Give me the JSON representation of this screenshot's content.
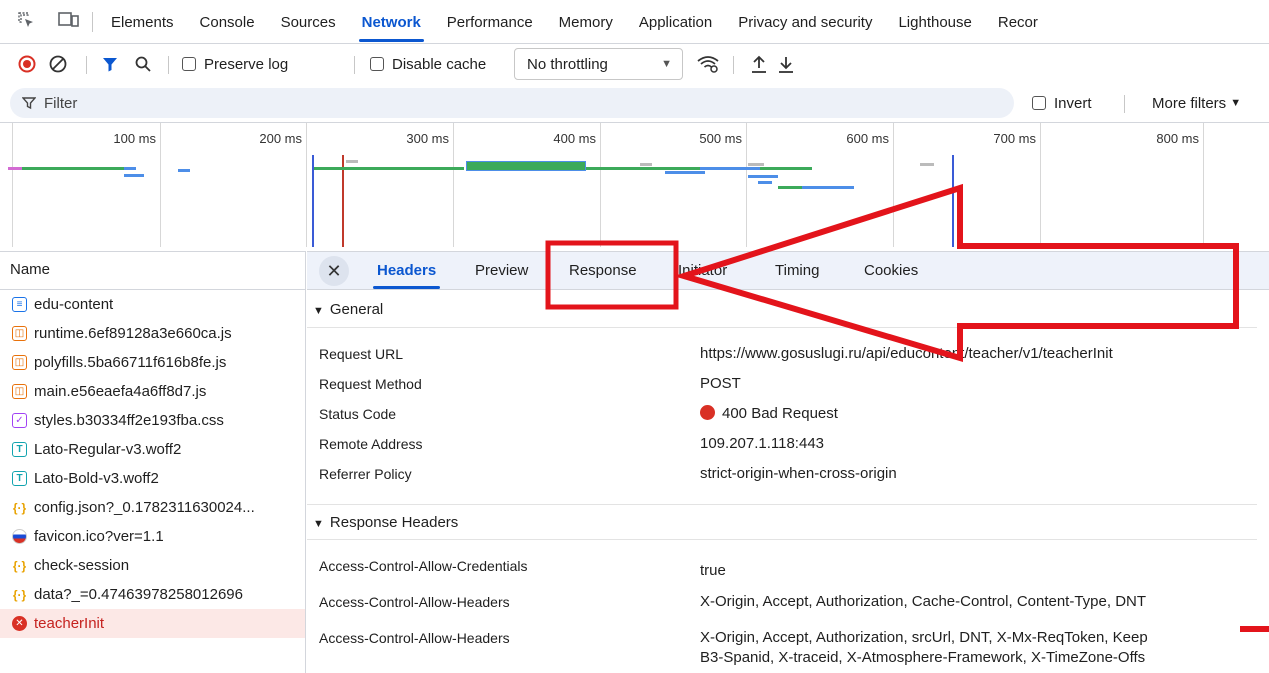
{
  "top_tabs": [
    "Elements",
    "Console",
    "Sources",
    "Network",
    "Performance",
    "Memory",
    "Application",
    "Privacy and security",
    "Lighthouse",
    "Recor"
  ],
  "active_tab": "Network",
  "toolbar": {
    "preserve_log": "Preserve log",
    "disable_cache": "Disable cache",
    "throttling": "No throttling"
  },
  "filter": {
    "placeholder": "Filter",
    "invert": "Invert",
    "more_filters": "More filters"
  },
  "timeline": {
    "ticks": [
      "100 ms",
      "200 ms",
      "300 ms",
      "400 ms",
      "500 ms",
      "600 ms",
      "700 ms",
      "800 ms"
    ]
  },
  "request_list": {
    "header": "Name",
    "items": [
      {
        "name": "edu-content",
        "type": "doc",
        "color": "#1a73e8"
      },
      {
        "name": "runtime.6ef89128a3e660ca.js",
        "type": "script",
        "color": "#e8710a"
      },
      {
        "name": "polyfills.5ba66711f616b8fe.js",
        "type": "script",
        "color": "#e8710a"
      },
      {
        "name": "main.e56eaefa4a6ff8d7.js",
        "type": "script",
        "color": "#e8710a"
      },
      {
        "name": "styles.b30334ff2e193fba.css",
        "type": "style",
        "color": "#a142f4"
      },
      {
        "name": "Lato-Regular-v3.woff2",
        "type": "font",
        "color": "#12a4af"
      },
      {
        "name": "Lato-Bold-v3.woff2",
        "type": "font",
        "color": "#12a4af"
      },
      {
        "name": "config.json?_0.1782311630024...",
        "type": "fetch",
        "color": "#e8a200"
      },
      {
        "name": "favicon.ico?ver=1.1",
        "type": "image",
        "color": "#1a4bd6"
      },
      {
        "name": "check-session",
        "type": "fetch",
        "color": "#e8a200"
      },
      {
        "name": "data?_=0.47463978258012696",
        "type": "fetch",
        "color": "#e8a200"
      },
      {
        "name": "teacherInit",
        "type": "error",
        "color": "#d93025"
      }
    ]
  },
  "detail_tabs": [
    "Headers",
    "Preview",
    "Response",
    "Initiator",
    "Timing",
    "Cookies"
  ],
  "active_detail_tab": "Headers",
  "general": {
    "title": "General",
    "rows": [
      {
        "key": "Request URL",
        "value": "https://www.gosuslugi.ru/api/educontent/teacher/v1/teacherInit"
      },
      {
        "key": "Request Method",
        "value": "POST"
      },
      {
        "key": "Status Code",
        "value": "400 Bad Request"
      },
      {
        "key": "Remote Address",
        "value": "109.207.1.118:443"
      },
      {
        "key": "Referrer Policy",
        "value": "strict-origin-when-cross-origin"
      }
    ]
  },
  "response_headers": {
    "title": "Response Headers",
    "rows": [
      {
        "key": "Access-Control-Allow-Credentials",
        "value": "true"
      },
      {
        "key": "Access-Control-Allow-Headers",
        "value": "X-Origin, Accept, Authorization, Cache-Control, Content-Type, DNT"
      },
      {
        "key": "Access-Control-Allow-Headers",
        "value": "X-Origin, Accept, Authorization, srcUrl, DNT, X-Mx-ReqToken, Keep",
        "value2": "B3-Spanid, X-traceid, X-Atmosphere-Framework, X-TimeZone-Offs"
      }
    ]
  },
  "colors": {
    "accent": "#0b57d0",
    "error": "#d93025",
    "annotation": "#e3141b"
  }
}
